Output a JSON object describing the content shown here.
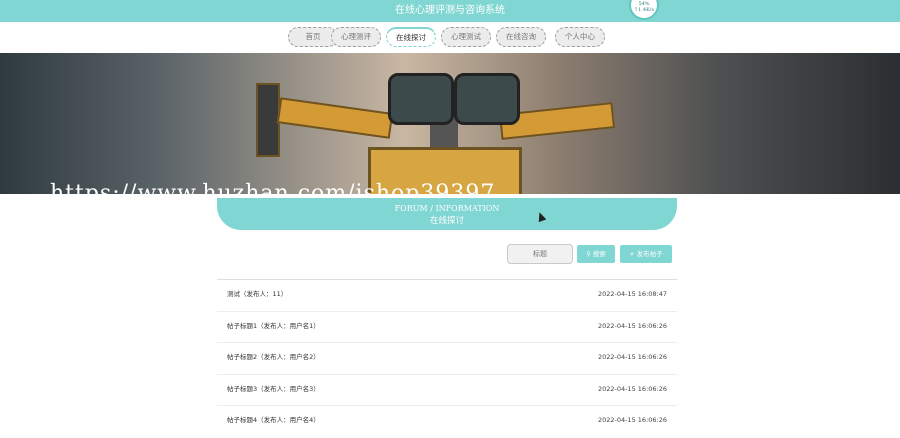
{
  "app": {
    "title": "在线心理评测与咨询系统"
  },
  "badge": {
    "line1": "54%",
    "line2": "↑1.4K/s"
  },
  "nav": [
    {
      "label": "首页"
    },
    {
      "label": "心理测评"
    },
    {
      "label": "在线探讨",
      "active": true
    },
    {
      "label": "心理测试"
    },
    {
      "label": "在线咨询"
    },
    {
      "label": "个人中心"
    }
  ],
  "banner": {
    "watermark": "https://www.huzhan.com/ishop39397"
  },
  "section": {
    "en": "FORUM / INFORMATION",
    "zh": "在线探讨"
  },
  "search": {
    "placeholder": "标题",
    "search_label": "搜索",
    "post_label": "发布帖子"
  },
  "posts": [
    {
      "title": "测试（发布人：11）",
      "time": "2022-04-15 16:08:47"
    },
    {
      "title": "帖子标题1（发布人：用户名1）",
      "time": "2022-04-15 16:06:26"
    },
    {
      "title": "帖子标题2（发布人：用户名2）",
      "time": "2022-04-15 16:06:26"
    },
    {
      "title": "帖子标题3（发布人：用户名3）",
      "time": "2022-04-15 16:06:26"
    },
    {
      "title": "帖子标题4（发布人：用户名4）",
      "time": "2022-04-15 16:06:26"
    }
  ],
  "colors": {
    "accent": "#7fd6d2"
  }
}
